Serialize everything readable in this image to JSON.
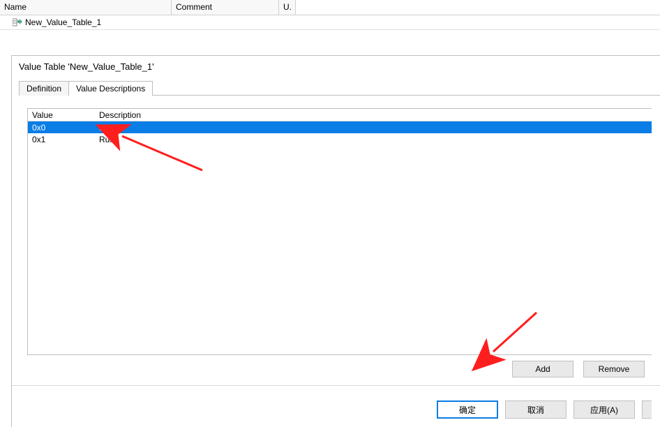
{
  "top_grid": {
    "headers": {
      "name": "Name",
      "comment": "Comment",
      "u": "U."
    },
    "rows": [
      {
        "name": "New_Value_Table_1",
        "comment": "",
        "u": ""
      }
    ]
  },
  "dialog": {
    "title": "Value Table 'New_Value_Table_1'",
    "tabs": [
      {
        "label": "Definition",
        "active": false
      },
      {
        "label": "Value Descriptions",
        "active": true
      }
    ],
    "list": {
      "headers": {
        "value": "Value",
        "description": "Description"
      },
      "rows": [
        {
          "value": "0x0",
          "description": "NO",
          "selected": true
        },
        {
          "value": "0x1",
          "description": "Run",
          "selected": false
        }
      ]
    },
    "actions": {
      "add": "Add",
      "remove": "Remove"
    },
    "bottom": {
      "ok": "确定",
      "cancel": "取消",
      "apply": "应用(A)"
    }
  },
  "colors": {
    "selection": "#0a7de6",
    "arrow": "#ff1e1e"
  }
}
